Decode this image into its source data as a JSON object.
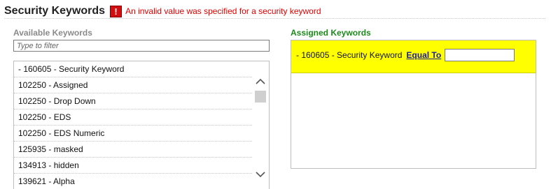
{
  "header": {
    "title": "Security Keywords",
    "error_icon": "error-exclamation-icon",
    "error_message": "An invalid value was specified for a security keyword"
  },
  "available": {
    "label": "Available Keywords",
    "filter_placeholder": "Type to filter",
    "filter_value": "",
    "items": [
      "- 160605 - Security Keyword",
      "102250 - Assigned",
      "102250 - Drop Down",
      "102250 - EDS",
      "102250 - EDS Numeric",
      "125935 - masked",
      "134913 - hidden",
      "139621 - Alpha"
    ]
  },
  "assigned": {
    "label": "Assigned Keywords",
    "items": [
      {
        "text": "- 160605 - Security Keyword",
        "operator": "Equal To",
        "value": ""
      }
    ]
  },
  "colors": {
    "error": "#e00000",
    "error_icon_bg": "#d01010",
    "assigned_label": "#1b8a1b",
    "available_label": "#8a8a8a",
    "assigned_highlight": "#ffff00",
    "link": "#1a1aa6"
  }
}
